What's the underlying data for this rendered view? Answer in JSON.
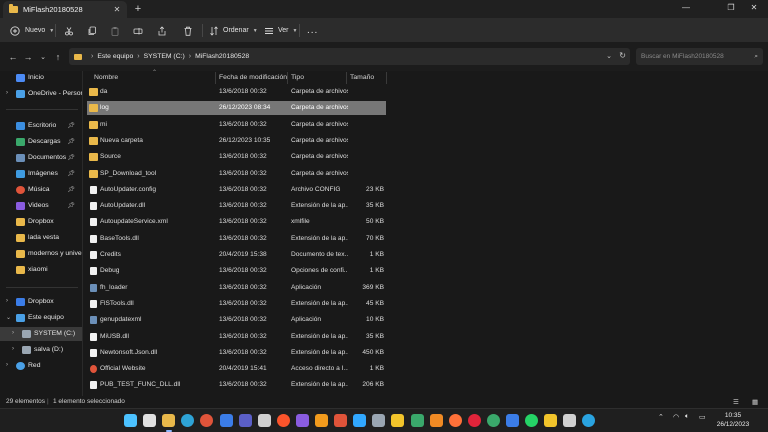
{
  "window": {
    "tab_title": "MiFlash20180528",
    "minimize_glyph": "—",
    "maximize_glyph": "❐",
    "close_glyph": "✕"
  },
  "toolbar": {
    "new_label": "Nuevo",
    "sort_label": "Ordenar",
    "view_label": "Ver",
    "more_label": "..."
  },
  "address": {
    "segments": [
      "Este equipo",
      "SYSTEM (C:)",
      "MiFlash20180528"
    ],
    "search_placeholder": "Buscar en MiFlash20180528"
  },
  "sidebar": {
    "items": [
      {
        "label": "Inicio",
        "icon": "home-icon",
        "color": "#4c8bf5"
      },
      {
        "label": "OneDrive - Persona",
        "icon": "cloud-icon",
        "color": "#4aa0e6"
      },
      {
        "label": "Escritorio",
        "icon": "desktop-icon",
        "color": "#3b8ee0"
      },
      {
        "label": "Descargas",
        "icon": "download-icon",
        "color": "#3aa86b"
      },
      {
        "label": "Documentos",
        "icon": "document-icon",
        "color": "#6b8fb8"
      },
      {
        "label": "Imágenes",
        "icon": "image-icon",
        "color": "#3f9be0"
      },
      {
        "label": "Música",
        "icon": "music-icon",
        "color": "#e0543a"
      },
      {
        "label": "Videos",
        "icon": "video-icon",
        "color": "#8a5ce0"
      },
      {
        "label": "Dropbox",
        "icon": "folder-icon",
        "color": "#e9b84a"
      },
      {
        "label": "lada vesta",
        "icon": "folder-icon",
        "color": "#e9b84a"
      },
      {
        "label": "modernos y univers",
        "icon": "folder-icon",
        "color": "#e9b84a"
      },
      {
        "label": "xiaomi",
        "icon": "folder-icon",
        "color": "#e9b84a"
      },
      {
        "label": "Dropbox",
        "icon": "dropbox-icon",
        "color": "#3b7de8"
      },
      {
        "label": "Este equipo",
        "icon": "computer-icon",
        "color": "#4aa0e6"
      },
      {
        "label": "SYSTEM (C:)",
        "icon": "drive-icon",
        "color": "#9aa6b2"
      },
      {
        "label": "salva (D:)",
        "icon": "drive-icon",
        "color": "#9aa6b2"
      },
      {
        "label": "Red",
        "icon": "network-icon",
        "color": "#4aa0e6"
      }
    ]
  },
  "columns": {
    "name": "Nombre",
    "date": "Fecha de modificación",
    "type": "Tipo",
    "size": "Tamaño"
  },
  "files": [
    {
      "name": "da",
      "date": "13/6/2018 00:32",
      "type": "Carpeta de archivos",
      "size": "",
      "icon": "folder-icon"
    },
    {
      "name": "log",
      "date": "26/12/2023 08:34",
      "type": "Carpeta de archivos",
      "size": "",
      "icon": "folder-icon"
    },
    {
      "name": "mi",
      "date": "13/6/2018 00:32",
      "type": "Carpeta de archivos",
      "size": "",
      "icon": "folder-icon"
    },
    {
      "name": "Nueva carpeta",
      "date": "26/12/2023 10:35",
      "type": "Carpeta de archivos",
      "size": "",
      "icon": "folder-icon"
    },
    {
      "name": "Source",
      "date": "13/6/2018 00:32",
      "type": "Carpeta de archivos",
      "size": "",
      "icon": "folder-icon"
    },
    {
      "name": "SP_Download_tool",
      "date": "13/6/2018 00:32",
      "type": "Carpeta de archivos",
      "size": "",
      "icon": "folder-icon"
    },
    {
      "name": "AutoUpdater.config",
      "date": "13/6/2018 00:32",
      "type": "Archivo CONFIG",
      "size": "23 KB",
      "icon": "file-icon"
    },
    {
      "name": "AutoUpdater.dll",
      "date": "13/6/2018 00:32",
      "type": "Extensión de la ap...",
      "size": "35 KB",
      "icon": "file-icon"
    },
    {
      "name": "AutoupdateService.xml",
      "date": "13/6/2018 00:32",
      "type": "xmlfile",
      "size": "50 KB",
      "icon": "file-icon"
    },
    {
      "name": "BaseTools.dll",
      "date": "13/6/2018 00:32",
      "type": "Extensión de la ap...",
      "size": "70 KB",
      "icon": "file-icon"
    },
    {
      "name": "Credits",
      "date": "20/4/2019 15:38",
      "type": "Documento de tex...",
      "size": "1 KB",
      "icon": "file-icon"
    },
    {
      "name": "Debug",
      "date": "13/6/2018 00:32",
      "type": "Opciones de confi...",
      "size": "1 KB",
      "icon": "file-icon"
    },
    {
      "name": "fh_loader",
      "date": "13/6/2018 00:32",
      "type": "Aplicación",
      "size": "369 KB",
      "icon": "app-icon"
    },
    {
      "name": "FlSTools.dll",
      "date": "13/6/2018 00:32",
      "type": "Extensión de la ap...",
      "size": "45 KB",
      "icon": "file-icon"
    },
    {
      "name": "genupdatexml",
      "date": "13/6/2018 00:32",
      "type": "Aplicación",
      "size": "10 KB",
      "icon": "app-icon"
    },
    {
      "name": "MiUSB.dll",
      "date": "13/6/2018 00:32",
      "type": "Extensión de la ap...",
      "size": "35 KB",
      "icon": "file-icon"
    },
    {
      "name": "Newtonsoft.Json.dll",
      "date": "13/6/2018 00:32",
      "type": "Extensión de la ap...",
      "size": "450 KB",
      "icon": "file-icon"
    },
    {
      "name": "Official Website",
      "date": "20/4/2019 15:41",
      "type": "Acceso directo a I...",
      "size": "1 KB",
      "icon": "chrome-icon"
    },
    {
      "name": "PUB_TEST_FUNC_DLL.dll",
      "date": "13/6/2018 00:32",
      "type": "Extensión de la ap...",
      "size": "206 KB",
      "icon": "file-icon"
    }
  ],
  "selected_row": 1,
  "status": {
    "count": "29 elementos",
    "selected": "1 elemento seleccionado"
  },
  "taskbar": {
    "icons": [
      {
        "name": "windows-start-icon",
        "color": "#4cc2ff"
      },
      {
        "name": "search-icon",
        "color": "#e0e0e0"
      },
      {
        "name": "file-explorer-icon",
        "color": "#e9b84a"
      },
      {
        "name": "edge-icon",
        "color": "#2ea3d6"
      },
      {
        "name": "chrome-icon",
        "color": "#e0543a"
      },
      {
        "name": "word-icon",
        "color": "#3b7de8"
      },
      {
        "name": "teams-icon",
        "color": "#5b5fc7"
      },
      {
        "name": "task-view-icon",
        "color": "#d0d0d0"
      },
      {
        "name": "brave-icon",
        "color": "#fb542b"
      },
      {
        "name": "vpn-icon",
        "color": "#8a5ce0"
      },
      {
        "name": "magnifier-icon",
        "color": "#f29b1d"
      },
      {
        "name": "media-icon",
        "color": "#e0543a"
      },
      {
        "name": "photoshop-icon",
        "color": "#31a8ff"
      },
      {
        "name": "terminal-icon",
        "color": "#9aa6b2"
      },
      {
        "name": "aimp-icon",
        "color": "#f2c42b"
      },
      {
        "name": "maps-icon",
        "color": "#3aa86b"
      },
      {
        "name": "vlc-icon",
        "color": "#f08a24"
      },
      {
        "name": "firefox-icon",
        "color": "#ff7139"
      },
      {
        "name": "opera-icon",
        "color": "#e0243a"
      },
      {
        "name": "chrome2-icon",
        "color": "#3aa86b"
      },
      {
        "name": "store-icon",
        "color": "#3b7de8"
      },
      {
        "name": "whatsapp-icon",
        "color": "#25d366"
      },
      {
        "name": "notes-icon",
        "color": "#f2c42b"
      },
      {
        "name": "snip-icon",
        "color": "#d0d0d0"
      },
      {
        "name": "telegram-icon",
        "color": "#2aa3e0"
      }
    ],
    "time": "10:35",
    "date": "26/12/2023"
  }
}
